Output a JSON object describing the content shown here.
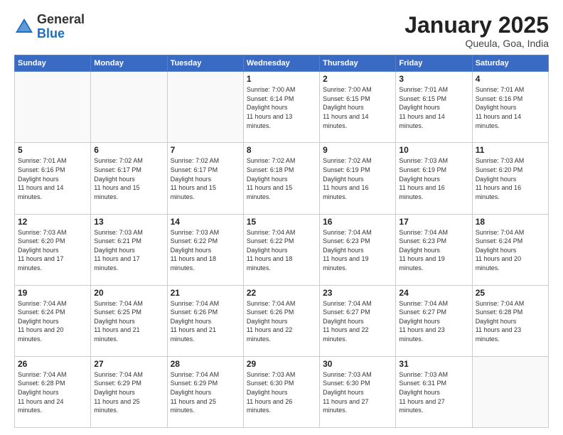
{
  "header": {
    "logo_general": "General",
    "logo_blue": "Blue",
    "month": "January 2025",
    "location": "Queula, Goa, India"
  },
  "weekdays": [
    "Sunday",
    "Monday",
    "Tuesday",
    "Wednesday",
    "Thursday",
    "Friday",
    "Saturday"
  ],
  "weeks": [
    [
      {
        "day": "",
        "empty": true
      },
      {
        "day": "",
        "empty": true
      },
      {
        "day": "",
        "empty": true
      },
      {
        "day": "1",
        "sunrise": "7:00 AM",
        "sunset": "6:14 PM",
        "daylight": "11 hours and 13 minutes."
      },
      {
        "day": "2",
        "sunrise": "7:00 AM",
        "sunset": "6:15 PM",
        "daylight": "11 hours and 14 minutes."
      },
      {
        "day": "3",
        "sunrise": "7:01 AM",
        "sunset": "6:15 PM",
        "daylight": "11 hours and 14 minutes."
      },
      {
        "day": "4",
        "sunrise": "7:01 AM",
        "sunset": "6:16 PM",
        "daylight": "11 hours and 14 minutes."
      }
    ],
    [
      {
        "day": "5",
        "sunrise": "7:01 AM",
        "sunset": "6:16 PM",
        "daylight": "11 hours and 14 minutes."
      },
      {
        "day": "6",
        "sunrise": "7:02 AM",
        "sunset": "6:17 PM",
        "daylight": "11 hours and 15 minutes."
      },
      {
        "day": "7",
        "sunrise": "7:02 AM",
        "sunset": "6:17 PM",
        "daylight": "11 hours and 15 minutes."
      },
      {
        "day": "8",
        "sunrise": "7:02 AM",
        "sunset": "6:18 PM",
        "daylight": "11 hours and 15 minutes."
      },
      {
        "day": "9",
        "sunrise": "7:02 AM",
        "sunset": "6:19 PM",
        "daylight": "11 hours and 16 minutes."
      },
      {
        "day": "10",
        "sunrise": "7:03 AM",
        "sunset": "6:19 PM",
        "daylight": "11 hours and 16 minutes."
      },
      {
        "day": "11",
        "sunrise": "7:03 AM",
        "sunset": "6:20 PM",
        "daylight": "11 hours and 16 minutes."
      }
    ],
    [
      {
        "day": "12",
        "sunrise": "7:03 AM",
        "sunset": "6:20 PM",
        "daylight": "11 hours and 17 minutes."
      },
      {
        "day": "13",
        "sunrise": "7:03 AM",
        "sunset": "6:21 PM",
        "daylight": "11 hours and 17 minutes."
      },
      {
        "day": "14",
        "sunrise": "7:03 AM",
        "sunset": "6:22 PM",
        "daylight": "11 hours and 18 minutes."
      },
      {
        "day": "15",
        "sunrise": "7:04 AM",
        "sunset": "6:22 PM",
        "daylight": "11 hours and 18 minutes."
      },
      {
        "day": "16",
        "sunrise": "7:04 AM",
        "sunset": "6:23 PM",
        "daylight": "11 hours and 19 minutes."
      },
      {
        "day": "17",
        "sunrise": "7:04 AM",
        "sunset": "6:23 PM",
        "daylight": "11 hours and 19 minutes."
      },
      {
        "day": "18",
        "sunrise": "7:04 AM",
        "sunset": "6:24 PM",
        "daylight": "11 hours and 20 minutes."
      }
    ],
    [
      {
        "day": "19",
        "sunrise": "7:04 AM",
        "sunset": "6:24 PM",
        "daylight": "11 hours and 20 minutes."
      },
      {
        "day": "20",
        "sunrise": "7:04 AM",
        "sunset": "6:25 PM",
        "daylight": "11 hours and 21 minutes."
      },
      {
        "day": "21",
        "sunrise": "7:04 AM",
        "sunset": "6:26 PM",
        "daylight": "11 hours and 21 minutes."
      },
      {
        "day": "22",
        "sunrise": "7:04 AM",
        "sunset": "6:26 PM",
        "daylight": "11 hours and 22 minutes."
      },
      {
        "day": "23",
        "sunrise": "7:04 AM",
        "sunset": "6:27 PM",
        "daylight": "11 hours and 22 minutes."
      },
      {
        "day": "24",
        "sunrise": "7:04 AM",
        "sunset": "6:27 PM",
        "daylight": "11 hours and 23 minutes."
      },
      {
        "day": "25",
        "sunrise": "7:04 AM",
        "sunset": "6:28 PM",
        "daylight": "11 hours and 23 minutes."
      }
    ],
    [
      {
        "day": "26",
        "sunrise": "7:04 AM",
        "sunset": "6:28 PM",
        "daylight": "11 hours and 24 minutes."
      },
      {
        "day": "27",
        "sunrise": "7:04 AM",
        "sunset": "6:29 PM",
        "daylight": "11 hours and 25 minutes."
      },
      {
        "day": "28",
        "sunrise": "7:04 AM",
        "sunset": "6:29 PM",
        "daylight": "11 hours and 25 minutes."
      },
      {
        "day": "29",
        "sunrise": "7:03 AM",
        "sunset": "6:30 PM",
        "daylight": "11 hours and 26 minutes."
      },
      {
        "day": "30",
        "sunrise": "7:03 AM",
        "sunset": "6:30 PM",
        "daylight": "11 hours and 27 minutes."
      },
      {
        "day": "31",
        "sunrise": "7:03 AM",
        "sunset": "6:31 PM",
        "daylight": "11 hours and 27 minutes."
      },
      {
        "day": "",
        "empty": true
      }
    ]
  ]
}
